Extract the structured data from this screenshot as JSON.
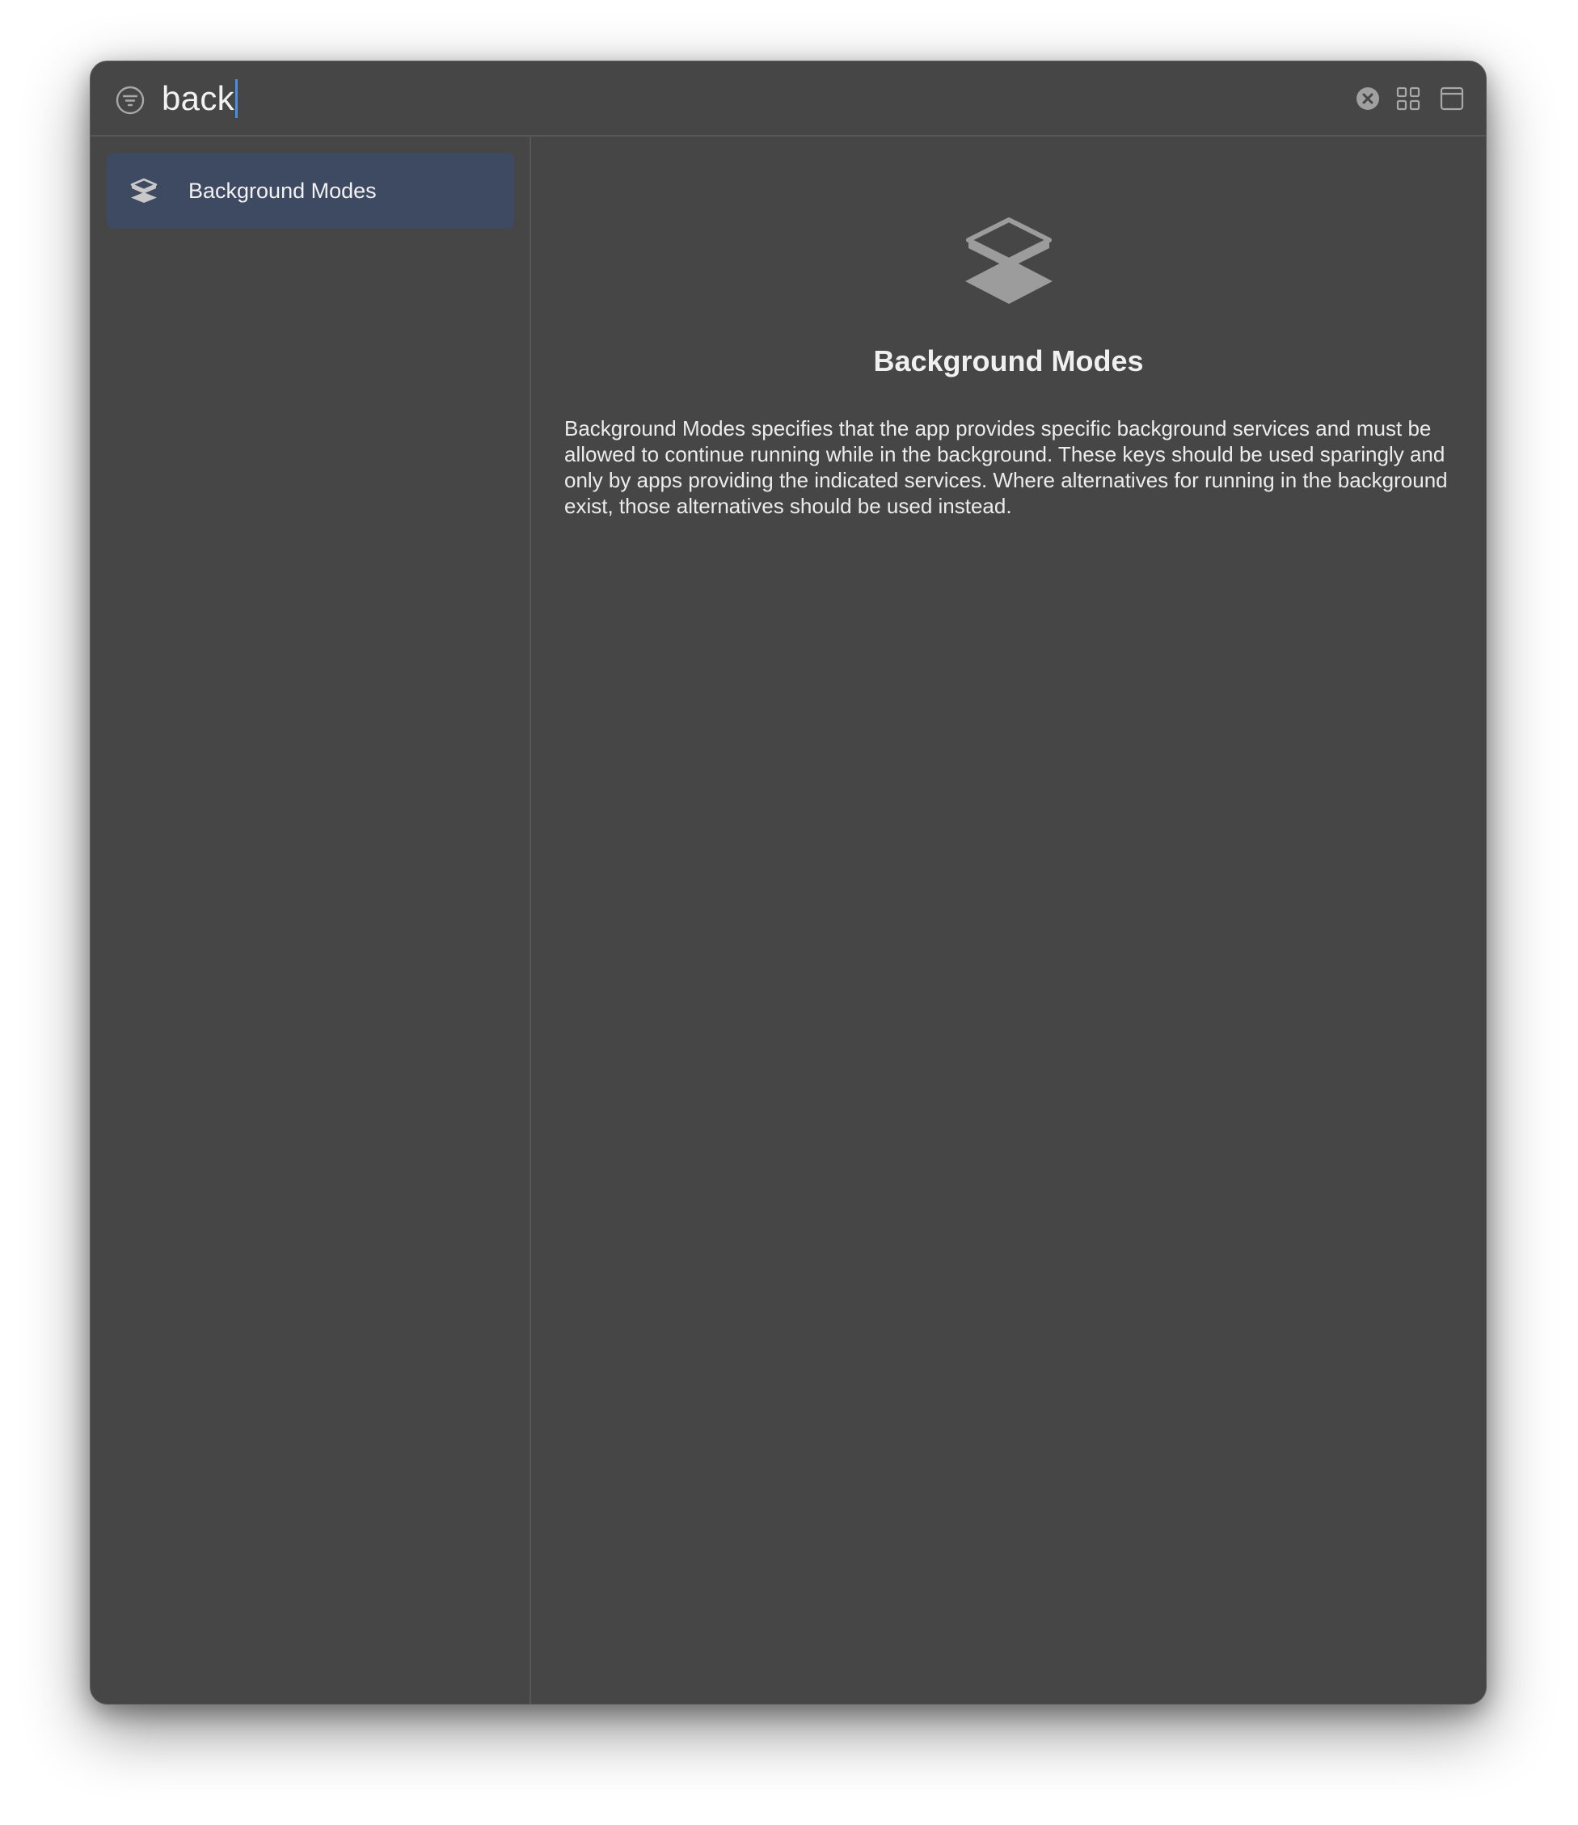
{
  "search": {
    "query": "back",
    "filter_icon": "filter-circle-icon",
    "clear_icon": "clear-circle-icon"
  },
  "toolbar": {
    "grid_icon": "grid-view-icon",
    "window_icon": "window-layout-icon"
  },
  "sidebar": {
    "items": [
      {
        "label": "Background Modes",
        "icon": "layers-icon",
        "selected": true
      }
    ]
  },
  "detail": {
    "title": "Background Modes",
    "icon": "layers-icon",
    "description": "Background Modes specifies that the app provides specific background services and must be allowed to continue running while in the background. These keys should be used sparingly and only by apps providing the indicated services. Where alternatives for running in the background exist, those alternatives should be used instead."
  },
  "colors": {
    "window_bg": "#464646",
    "selection_bg": "#3e4a61",
    "caret": "#4a90e2"
  }
}
